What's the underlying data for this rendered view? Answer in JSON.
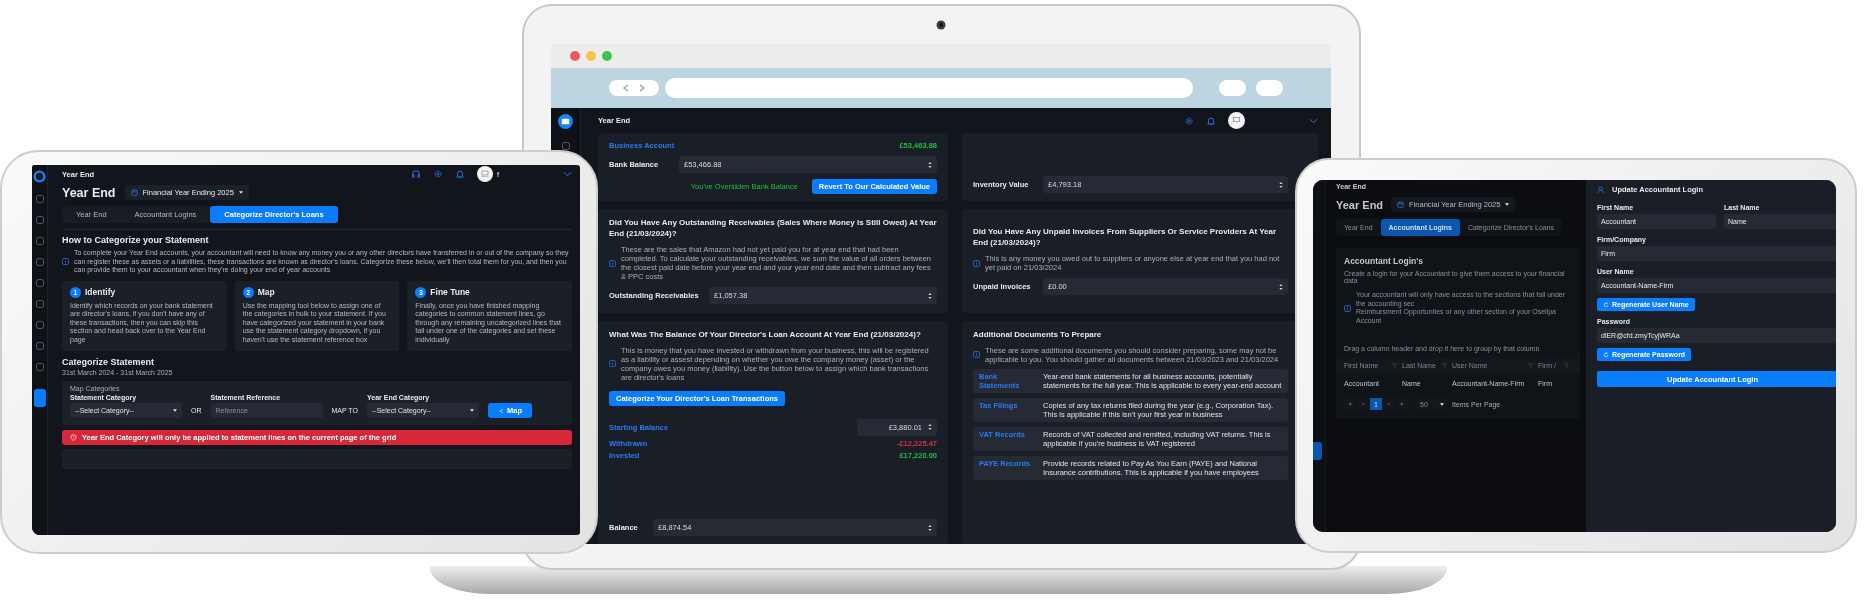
{
  "left_tablet": {
    "breadcrumb": "Year End",
    "user_initial": "f",
    "title": "Year End",
    "year_selector": "Financial Year Ending 2025",
    "tabs": [
      {
        "label": "Year End",
        "selected": false
      },
      {
        "label": "Accountant Logins",
        "selected": false
      },
      {
        "label": "Categorize Director's Loans",
        "selected": true
      }
    ],
    "guide_title": "How to Categorize your Statement",
    "guide_info": "To complete your Year End accounts, your accountant will need to know any money you or any other directors have transferred in or out of the company so they can register these as assets or a liabilities, these transactions are known as director's loans. Categorize these below, we'll then total them for you, and then you can provide them to your accountant when they're doing your end of year accounts",
    "steps": [
      {
        "number": "1",
        "title": "Identify",
        "text": "Identify which records on your bank statement are director's loans, if you don't have any of these transactions, then you can skip this section and head back over to the Year End page"
      },
      {
        "number": "2",
        "title": "Map",
        "text": "Use the mapping tool below to assign one of the categories in bulk to your statement. If you have categorized your statement in your bank use the statement category dropdown, if you haven't use the statement reference box"
      },
      {
        "number": "3",
        "title": "Fine Tune",
        "text": "Finally, once you have finished mapping categories to common statement lines, go through any remaining uncategorized lines that fall under one of the categories and set these individually"
      }
    ],
    "categorize_title": "Categorize Statement",
    "date_range": "31st March 2024 - 31st March 2025",
    "map_panel": {
      "heading": "Map Categories",
      "statement_category": {
        "label": "Statement Category",
        "value": "--Select Category--"
      },
      "or": "OR",
      "statement_reference": {
        "label": "Statement Reference",
        "placeholder": "Reference"
      },
      "map_to": "MAP TO",
      "year_end_category": {
        "label": "Year End Category",
        "value": "--Select Category--"
      },
      "button": "Map"
    },
    "alert": "Year End Category will only be applied to statement lines on the current page of the grid"
  },
  "laptop": {
    "breadcrumb": "Year End",
    "business_account": {
      "label": "Business Account",
      "amount": "£53,463.88"
    },
    "bank_balance": {
      "label": "Bank Balance",
      "value": "£53,466.88"
    },
    "override_note": "You've Overidden Bank Balance",
    "revert_button": "Revert To Our Calculated Value",
    "receivables": {
      "question": "Did You Have Any Outstanding Receivables (Sales Where Money Is Still Owed) At Year End (21/03/2024)?",
      "info": "These are the sales that Amazon had not yet paid you for at year end that had been completed. To calculate your outstanding receivables, we sum the value of all orders between the closest paid date before your year end and your year end date and then subtract any fees & PPC costs",
      "label": "Outstanding Receivables",
      "value": "£1,057.38"
    },
    "loan": {
      "question": "What Was The Balance Of Your Director's Loan Account At Year End (21/03/2024)?",
      "info": "This is money that you have invested or withdrawn from your business, this will be registered as a liability or assest depending on whether you owe the company money (asset) or the company owes you money (liability). Use the button below to assign which bank transactions are director's loans",
      "button": "Categorize Your Director's Loan Transactions",
      "starting_balance": {
        "label": "Starting Balance",
        "value": "£3,880.01"
      },
      "movements": [
        {
          "label": "Withdrawn",
          "amount": "-£12,225.47",
          "kind": "negative"
        },
        {
          "label": "Invested",
          "amount": "£17,220.00",
          "kind": "positive"
        }
      ],
      "balance": {
        "label": "Balance",
        "value": "£8,874.54"
      }
    },
    "inventory": {
      "label": "Inventory Value",
      "value": "£4,793.18"
    },
    "unpaid": {
      "question": "Did You Have Any Unpaid Invoices From Suppliers Or Service Providers At Year End (21/03/2024)?",
      "info": "This is any money you owed out to suppliers or anyone else at year end that you had not yet paid on 21/03/2024",
      "label": "Unpaid Invoices",
      "value": "£0.00"
    },
    "documents": {
      "title": "Additional Documents To Prepare",
      "info": "These are some additional documents you should consider preparing, some may not be applicable to you. You should gather all documents between 21/03/2023 and 21/03/2024",
      "items": [
        {
          "name": "Bank Statements",
          "description": "Year-end bank statements for all business accounts, potentially statements for the full year. This is applicable to every year-end account"
        },
        {
          "name": "Tax Filings",
          "description": "Copies of any tax returns filed during the year (e.g., Corporation Tax). This is applicable if this isn't your first year in business"
        },
        {
          "name": "VAT Records",
          "description": "Records of VAT collected and remitted, including VAT returns. This is applicable if you're business is VAT registered"
        },
        {
          "name": "PAYE Records",
          "description": "Provide records related to Pay As You Earn (PAYE) and National Insurance contributions. This is applicable if you have employees"
        }
      ]
    }
  },
  "right_tablet": {
    "breadcrumb": "Year End",
    "title": "Year End",
    "year_selector": "Financial Year Ending 2025",
    "tabs": [
      {
        "label": "Year End",
        "selected": false
      },
      {
        "label": "Accountant Logins",
        "selected": true
      },
      {
        "label": "Categorize Director's Loans",
        "selected": false
      }
    ],
    "section_title": "Accountant Login's",
    "subtitle": "Create a login for your Accountant to give them access to your financial data",
    "info_lines": [
      "Your accountant will only have access to the sections that fall under the accounting sec",
      "Reimbursment Opportunties or any other section of your Osellpa Account"
    ],
    "group_hint": "Drag a column header and drop it here to group by that column",
    "table": {
      "columns": [
        "First Name",
        "Last Name",
        "User Name",
        "Firm /"
      ],
      "rows": [
        [
          "Accountant",
          "Name",
          "Accountant-Name-Firm",
          "Firm"
        ]
      ]
    },
    "pagination": {
      "pages": [
        {
          "label": "1",
          "selected": true
        }
      ],
      "page_size": "50",
      "per_page_label": "Items Per Page"
    },
    "drawer": {
      "title": "Update Accountant Login",
      "first_name": {
        "label": "First Name",
        "value": "Accountant"
      },
      "last_name": {
        "label": "Last Name",
        "value": "Name"
      },
      "firm": {
        "label": "Firm/Company",
        "value": "Firm"
      },
      "user_name": {
        "label": "User Name",
        "value": "Accountant-Name-Firm"
      },
      "regenerate_user_name": "Regenerate User Name",
      "password": {
        "label": "Password",
        "value": "dlER@cfd.zmyTcyjWRAa"
      },
      "regenerate_password": "Regenerate Password",
      "submit": "Update Accountant Login"
    }
  }
}
